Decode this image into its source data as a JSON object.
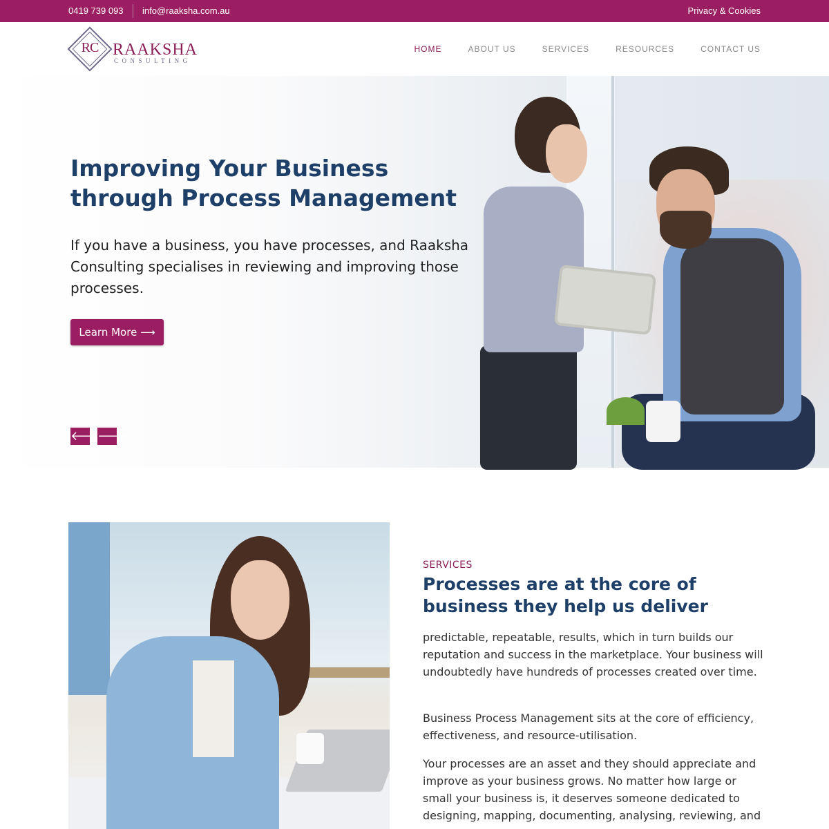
{
  "topbar": {
    "phone": "0419 739 093",
    "email": "info@raaksha.com.au",
    "privacy": "Privacy & Cookies"
  },
  "logo": {
    "monogram": "RC",
    "name": "RAAKSHA",
    "sub": "CONSULTING"
  },
  "nav": {
    "items": [
      {
        "label": "HOME",
        "active": true
      },
      {
        "label": "ABOUT US"
      },
      {
        "label": "SERVICES"
      },
      {
        "label": "RESOURCES"
      },
      {
        "label": "CONTACT US"
      }
    ]
  },
  "hero": {
    "title": "Improving Your Business through Process Management",
    "text": "If you have a business, you have processes, and Raaksha Consulting specialises in reviewing and improving those processes.",
    "button": "Learn More ⟶",
    "prev": "🡐",
    "next": "🡒"
  },
  "services": {
    "label": "SERVICES",
    "title": "Processes are at the core of business they help us deliver",
    "paragraphs": [
      "predictable, repeatable, results, which in turn builds our reputation and success in the marketplace. Your business will undoubtedly have hundreds of processes created over time.",
      "Business Process Management sits at the core of efficiency, effectiveness, and resource-utilisation.",
      "Your processes are an asset and they should appreciate and improve as your business grows. No matter how large or small your business is, it deserves someone dedicated to designing, mapping, documenting, analysing, reviewing, and"
    ]
  },
  "colors": {
    "brand": "#9b1e62",
    "heading": "#1d3f68"
  }
}
